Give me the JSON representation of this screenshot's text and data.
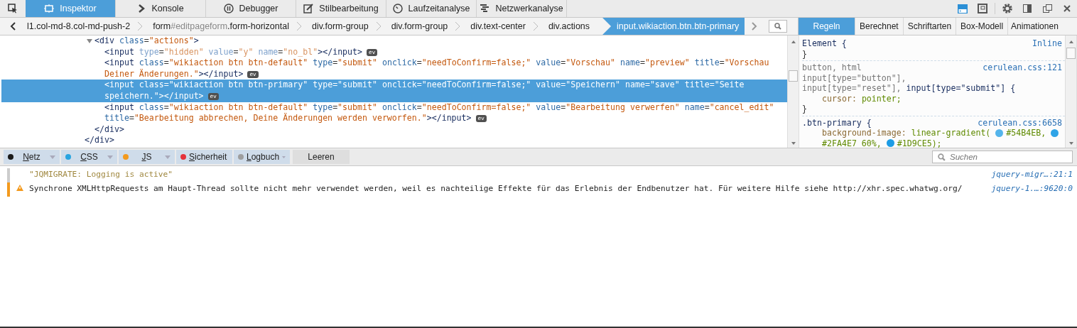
{
  "toolbar": {
    "tabs": [
      {
        "label": "Inspektor",
        "selected": true
      },
      {
        "label": "Konsole",
        "selected": false
      },
      {
        "label": "Debugger",
        "selected": false
      },
      {
        "label": "Stilbearbeitung",
        "selected": false
      },
      {
        "label": "Laufzeitanalyse",
        "selected": false
      },
      {
        "label": "Netzwerkanalyse",
        "selected": false
      }
    ],
    "buttons": [
      {
        "on": true
      },
      {
        "on": false
      },
      {
        "on": false
      },
      {
        "on": false
      },
      {
        "on": false
      },
      {
        "on": false
      }
    ]
  },
  "breadcrumbs": {
    "items": [
      {
        "classes": "l1.col-md-8.col-md-push-2",
        "selected": false
      },
      {
        "tag": "form",
        "id": "#editpageform",
        "classes": ".form-horizontal",
        "selected": false
      },
      {
        "tag": "div",
        "classes": ".form-group",
        "selected": false
      },
      {
        "tag": "div",
        "classes": ".form-group",
        "selected": false
      },
      {
        "tag": "div",
        "classes": ".text-center",
        "selected": false
      },
      {
        "tag": "div",
        "classes": ".actions",
        "selected": false
      },
      {
        "tag": "input",
        "classes": ".wikiaction.btn.btn-primary",
        "selected": true
      }
    ]
  },
  "markup": {
    "children": [
      {
        "expanded": true,
        "selected": false,
        "dimmed": false,
        "tokens": [
          {
            "kind": "tag",
            "text": "<div"
          },
          {
            "kind": "attr",
            "text": " class"
          },
          {
            "kind": "punct",
            "text": "="
          },
          {
            "kind": "val",
            "text": "\"actions\""
          },
          {
            "kind": "tag",
            "text": ">"
          }
        ],
        "children": [
          {
            "selected": false,
            "dimmed": true,
            "badge": "ev",
            "tokens": [
              {
                "kind": "tag",
                "text": "<input"
              },
              {
                "kind": "attr",
                "text": " type"
              },
              {
                "kind": "punct",
                "text": "="
              },
              {
                "kind": "val",
                "text": "\"hidden\""
              },
              {
                "kind": "attr",
                "text": " value"
              },
              {
                "kind": "punct",
                "text": "="
              },
              {
                "kind": "val",
                "text": "\"y\""
              },
              {
                "kind": "attr",
                "text": " name"
              },
              {
                "kind": "punct",
                "text": "="
              },
              {
                "kind": "val",
                "text": "\"no_bl\""
              },
              {
                "kind": "tag",
                "text": "></input>"
              }
            ]
          },
          {
            "selected": false,
            "dimmed": false,
            "badge": "ev",
            "tokens": [
              {
                "kind": "tag",
                "text": "<input"
              },
              {
                "kind": "attr",
                "text": " class"
              },
              {
                "kind": "punct",
                "text": "="
              },
              {
                "kind": "val",
                "text": "\"wikiaction btn btn-default\""
              },
              {
                "kind": "attr",
                "text": " type"
              },
              {
                "kind": "punct",
                "text": "="
              },
              {
                "kind": "val",
                "text": "\"submit\""
              },
              {
                "kind": "attr",
                "text": " onclick"
              },
              {
                "kind": "punct",
                "text": "="
              },
              {
                "kind": "val",
                "text": "\"needToConfirm=false;\""
              },
              {
                "kind": "attr",
                "text": " value"
              },
              {
                "kind": "punct",
                "text": "="
              },
              {
                "kind": "val",
                "text": "\"Vorschau\""
              },
              {
                "kind": "attr",
                "text": " name"
              },
              {
                "kind": "punct",
                "text": "="
              },
              {
                "kind": "val",
                "text": "\"preview\""
              },
              {
                "kind": "attr",
                "text": " title"
              },
              {
                "kind": "punct",
                "text": "="
              },
              {
                "kind": "val",
                "text": "\"Vorschau Deiner Änderungen.\""
              },
              {
                "kind": "tag",
                "text": "></input>"
              }
            ]
          },
          {
            "selected": true,
            "dimmed": false,
            "badge": "ev",
            "tokens": [
              {
                "kind": "tag",
                "text": "<input"
              },
              {
                "kind": "attr",
                "text": " class"
              },
              {
                "kind": "punct",
                "text": "="
              },
              {
                "kind": "val",
                "text": "\"wikiaction btn btn-primary\""
              },
              {
                "kind": "attr",
                "text": " type"
              },
              {
                "kind": "punct",
                "text": "="
              },
              {
                "kind": "val",
                "text": "\"submit\""
              },
              {
                "kind": "attr",
                "text": " onclick"
              },
              {
                "kind": "punct",
                "text": "="
              },
              {
                "kind": "val",
                "text": "\"needToConfirm=false;\""
              },
              {
                "kind": "attr",
                "text": " value"
              },
              {
                "kind": "punct",
                "text": "="
              },
              {
                "kind": "val",
                "text": "\"Speichern\""
              },
              {
                "kind": "attr",
                "text": " name"
              },
              {
                "kind": "punct",
                "text": "="
              },
              {
                "kind": "val",
                "text": "\"save\""
              },
              {
                "kind": "attr",
                "text": " title"
              },
              {
                "kind": "punct",
                "text": "="
              },
              {
                "kind": "val",
                "text": "\"Seite speichern.\""
              },
              {
                "kind": "tag",
                "text": "></input>"
              }
            ]
          },
          {
            "selected": false,
            "dimmed": false,
            "badge": "ev",
            "tokens": [
              {
                "kind": "tag",
                "text": "<input"
              },
              {
                "kind": "attr",
                "text": " class"
              },
              {
                "kind": "punct",
                "text": "="
              },
              {
                "kind": "val",
                "text": "\"wikiaction btn btn-default\""
              },
              {
                "kind": "attr",
                "text": " type"
              },
              {
                "kind": "punct",
                "text": "="
              },
              {
                "kind": "val",
                "text": "\"submit\""
              },
              {
                "kind": "attr",
                "text": " onclick"
              },
              {
                "kind": "punct",
                "text": "="
              },
              {
                "kind": "val",
                "text": "\"needToConfirm=false;\""
              },
              {
                "kind": "attr",
                "text": " value"
              },
              {
                "kind": "punct",
                "text": "="
              },
              {
                "kind": "val",
                "text": "\"Bearbeitung verwerfen\""
              },
              {
                "kind": "attr",
                "text": " name"
              },
              {
                "kind": "punct",
                "text": "="
              },
              {
                "kind": "val",
                "text": "\"cancel_edit\""
              },
              {
                "kind": "attr",
                "text": " title"
              },
              {
                "kind": "punct",
                "text": "="
              },
              {
                "kind": "val",
                "text": "\"Bearbeitung abbrechen, Deine Änderungen werden verworfen.\""
              },
              {
                "kind": "tag",
                "text": "></input>"
              }
            ]
          }
        ],
        "close": [
          {
            "kind": "tag",
            "text": "</div>"
          }
        ]
      }
    ],
    "close": [
      {
        "kind": "tag",
        "text": "</div>"
      }
    ]
  },
  "styles": {
    "tabs": [
      {
        "label": "Regeln",
        "selected": true
      },
      {
        "label": "Berechnet",
        "selected": false
      },
      {
        "label": "Schriftarten",
        "selected": false
      },
      {
        "label": "Box-Modell",
        "selected": false
      },
      {
        "label": "Animationen",
        "selected": false
      }
    ],
    "rules": [
      {
        "source": "Inline",
        "selector_lines": [
          [
            {
              "text": "Element {",
              "matched": true
            }
          ]
        ],
        "close": "}"
      },
      {
        "source": "cerulean.css:121",
        "selector_lines": [
          [
            {
              "text": "button, html",
              "matched": false
            }
          ],
          [
            {
              "text": "input[type=\"button\"],",
              "matched": false
            }
          ],
          [
            {
              "text": "input[type=\"reset\"],",
              "matched": false
            },
            {
              "text": "input[type=\"submit\"] {",
              "matched": true
            }
          ]
        ],
        "declarations": [
          {
            "property": "cursor:",
            "value": [
              {
                "kind": "text",
                "text": "pointer;"
              }
            ]
          }
        ],
        "close": "}"
      },
      {
        "source": "cerulean.css:6658",
        "selector_lines": [
          [
            {
              "text": ".btn-primary {",
              "matched": true
            }
          ]
        ],
        "declarations": [
          {
            "property": "background-image:",
            "value": [
              {
                "kind": "text",
                "text": "linear-gradient("
              },
              {
                "kind": "swatch",
                "color": "#54b4eb"
              },
              {
                "kind": "text",
                "text": "#54B4EB,"
              },
              {
                "kind": "swatch",
                "color": "#2fa4e7"
              },
              {
                "kind": "text",
                "text": "#2FA4E7 60%,"
              },
              {
                "kind": "swatch",
                "color": "#1d9ce5"
              },
              {
                "kind": "text",
                "text": "#1D9CE5);"
              }
            ]
          }
        ]
      }
    ]
  },
  "console": {
    "filters": [
      {
        "label": "Netz",
        "color": "#1a1a1a"
      },
      {
        "label": "CSS",
        "color": "#2aa5e0"
      },
      {
        "label": "JS",
        "color": "#f39a1e"
      },
      {
        "label": "Sicherheit",
        "color": "#e5323b"
      },
      {
        "label": "Logbuch",
        "color": "#9e9e9e"
      }
    ],
    "clear_button": "Leeren",
    "search": {
      "placeholder": "Suchen"
    },
    "messages": [
      {
        "kind": "log",
        "text": "\"JQMIGRATE: Logging is active\"",
        "source": "jquery-migr…:21:1"
      },
      {
        "kind": "warning",
        "text": "Synchrone XMLHttpRequests am Haupt-Thread sollte nicht mehr verwendet werden, weil es nachteilige Effekte für das Erlebnis der Endbenutzer hat. Für weitere Hilfe siehe http://xhr.spec.whatwg.org/",
        "source": "jquery-1.…:9620:0"
      }
    ]
  }
}
